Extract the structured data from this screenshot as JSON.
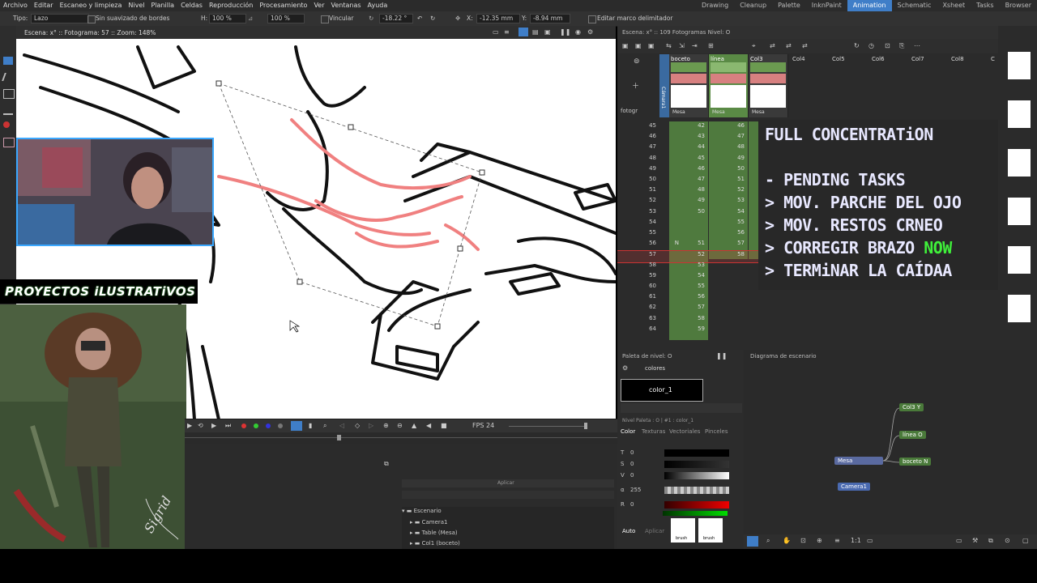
{
  "menu": [
    "Archivo",
    "Editar",
    "Escaneo y limpieza",
    "Nivel",
    "Planilla",
    "Celdas",
    "Reproducción",
    "Procesamiento",
    "Ver",
    "Ventanas",
    "Ayuda"
  ],
  "rooms": [
    {
      "label": "Drawing",
      "active": false
    },
    {
      "label": "Cleanup",
      "active": false
    },
    {
      "label": "Palette",
      "active": false
    },
    {
      "label": "InknPaint",
      "active": false
    },
    {
      "label": "Animation",
      "active": true
    },
    {
      "label": "Schematic",
      "active": false
    },
    {
      "label": "Xsheet",
      "active": false
    },
    {
      "label": "Tasks",
      "active": false
    },
    {
      "label": "Browser",
      "active": false
    }
  ],
  "tool_options": {
    "tipo_label": "Tipo:",
    "tipo_value": "Lazo",
    "smooth_label": "Sin suavizado de bordes",
    "h_label": "H:",
    "h_value": "100 %",
    "v_value": "100 %",
    "link_label": "Vincular",
    "rotation": "-18.22 °",
    "x_label": "X:",
    "x_value": "-12.35 mm",
    "y_label": "Y:",
    "y_value": "-8.94 mm",
    "bbox_label": "Editar marco delimitador"
  },
  "viewer": {
    "header": "Escena: x° :: Fotograma: 57 :: Zoom: 148%"
  },
  "flipbar": {
    "fps_label": "FPS",
    "fps_value": "24"
  },
  "xsheet": {
    "header": "Escena: x° :: 109 Fotogramas  Nivel: O",
    "frame_label": "fotogr",
    "camera_label": "Cámara1",
    "columns": [
      {
        "name": "boceto",
        "footer": "Mesa",
        "active": false
      },
      {
        "name": "línea",
        "footer": "Mesa",
        "active": true
      },
      {
        "name": "Col3",
        "footer": "Mesa",
        "active": false
      },
      {
        "name": "Col4"
      },
      {
        "name": "Col5"
      },
      {
        "name": "Col6"
      },
      {
        "name": "Col7"
      },
      {
        "name": "Col8"
      },
      {
        "name": "C"
      }
    ],
    "rows": [
      {
        "f": "45",
        "a": "42",
        "b": "46"
      },
      {
        "f": "46",
        "a": "43",
        "b": "47"
      },
      {
        "f": "47",
        "a": "44",
        "b": "48"
      },
      {
        "f": "48",
        "a": "45",
        "b": "49"
      },
      {
        "f": "49",
        "a": "46",
        "b": "50"
      },
      {
        "f": "50",
        "a": "47",
        "b": "51"
      },
      {
        "f": "51",
        "a": "48",
        "b": "52"
      },
      {
        "f": "52",
        "a": "49",
        "b": "53"
      },
      {
        "f": "53",
        "a": "50",
        "b": "54"
      },
      {
        "f": "54",
        "a": "",
        "b": "55"
      },
      {
        "f": "55",
        "a": "",
        "b": "56"
      },
      {
        "f": "56",
        "a": "51",
        "b": "57",
        "mark": "N"
      },
      {
        "f": "57",
        "a": "52",
        "b": "58",
        "current": true
      },
      {
        "f": "58",
        "a": "53",
        "b": ""
      },
      {
        "f": "59",
        "a": "54",
        "b": ""
      },
      {
        "f": "60",
        "a": "55",
        "b": ""
      },
      {
        "f": "61",
        "a": "56",
        "b": ""
      },
      {
        "f": "62",
        "a": "57",
        "b": ""
      },
      {
        "f": "63",
        "a": "58",
        "b": ""
      },
      {
        "f": "64",
        "a": "59",
        "b": ""
      }
    ]
  },
  "overlay": {
    "title": "FULL CONCENTRATiON",
    "lines": [
      "- PENDING TASKS",
      "> MOV. PARCHE DEL OJO",
      "> MOV. RESTOS CRNEO",
      "> CORREGIR BRAZO ",
      "> TERMiNAR LA CAÍDAA"
    ],
    "now": "NOW"
  },
  "palette": {
    "title": "Paleta de nivel: O",
    "tab": "colores",
    "style_name": "color_1",
    "info": "Nivel Paleta : O | #1 : color_1",
    "tabs": [
      "Color",
      "Texturas",
      "Vectoriales",
      "Pinceles"
    ],
    "channels": [
      {
        "l": "T",
        "v": "0"
      },
      {
        "l": "S",
        "v": "0"
      },
      {
        "l": "V",
        "v": "0"
      },
      {
        "l": "α",
        "v": "255"
      },
      {
        "l": "R",
        "v": "0"
      }
    ],
    "auto": "Auto",
    "apply": "Aplicar",
    "brush1": "brush",
    "brush2": "brush"
  },
  "schematic": {
    "title": "Diagrama de escenario",
    "nodes": [
      {
        "label": "Col3",
        "sub": "Y"
      },
      {
        "label": "línea",
        "sub": "O"
      },
      {
        "label": "boceto",
        "sub": "N"
      },
      {
        "label": "Mesa"
      },
      {
        "label": "Camera1"
      }
    ]
  },
  "tree": {
    "items": [
      "Escenario",
      "Camera1",
      "Table (Mesa)",
      "Col1 (boceto)"
    ],
    "apply": "Aplicar"
  },
  "stream": {
    "banner": "PROYECTOS iLUSTRATiVOS",
    "signature": "Sigrid"
  },
  "colors": {
    "accent": "#3f7ec8",
    "active_col": "#5a8a45",
    "overlay_now": "#3ff03a",
    "stroke_red": "#f08080"
  }
}
